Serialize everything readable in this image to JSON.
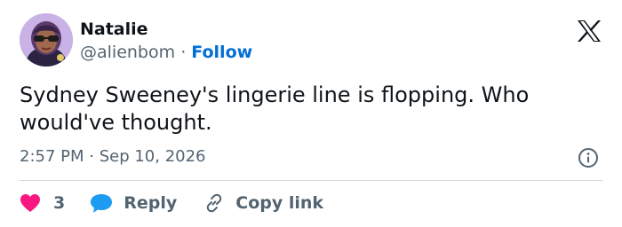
{
  "author": {
    "name": "Natalie",
    "handle": "@alienbom",
    "separator": "·",
    "follow_label": "Follow",
    "avatar_icon": "avatar-cartoon-woman-sunglasses"
  },
  "platform": {
    "logo_icon": "x-logo-icon"
  },
  "tweet": {
    "text": "Sydney Sweeney's lingerie line is flopping. Who would've thought.",
    "timestamp": "2:57 PM · Sep 10, 2026"
  },
  "actions": {
    "like_count": "3",
    "reply_label": "Reply",
    "copy_link_label": "Copy link"
  },
  "colors": {
    "like": "#f91880",
    "reply": "#1d9bf0",
    "follow": "#006fd6",
    "muted": "#536471",
    "text": "#0f1419"
  }
}
